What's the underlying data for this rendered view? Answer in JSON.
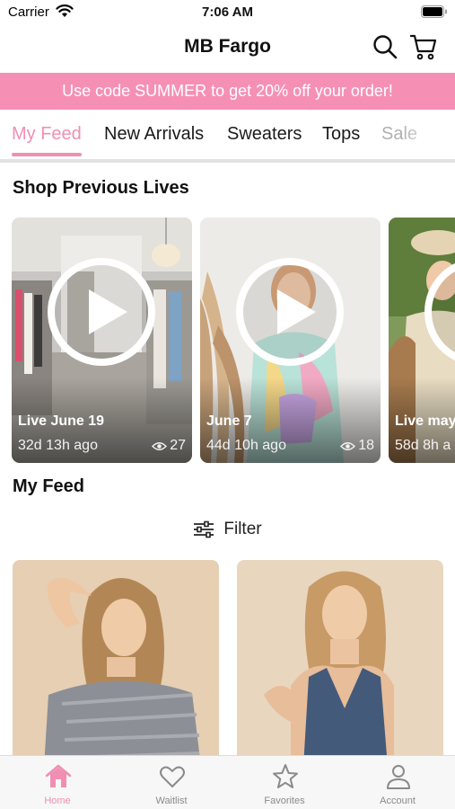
{
  "status_bar": {
    "carrier": "Carrier",
    "time": "7:06 AM"
  },
  "header": {
    "title": "MB Fargo",
    "icons": [
      "search-icon",
      "cart-icon"
    ]
  },
  "promo": {
    "text": "Use code SUMMER to get 20% off your order!",
    "color": "#f590b4"
  },
  "categories": [
    {
      "label": "My Feed",
      "active": true
    },
    {
      "label": "New Arrivals",
      "active": false
    },
    {
      "label": "Sweaters",
      "active": false
    },
    {
      "label": "Tops",
      "active": false
    },
    {
      "label": "Sale",
      "active": false
    }
  ],
  "lives": {
    "title": "Shop Previous Lives",
    "items": [
      {
        "title": "Live June 19",
        "ago": "32d 13h ago",
        "views": "27"
      },
      {
        "title": "June 7",
        "ago": "44d 10h ago",
        "views": "18"
      },
      {
        "title": "Live may",
        "ago": "58d 8h a",
        "views": ""
      }
    ]
  },
  "feed": {
    "title": "My Feed",
    "filter_label": "Filter"
  },
  "tab_bar": [
    {
      "label": "Home",
      "icon": "home-icon",
      "active": true
    },
    {
      "label": "Waitlist",
      "icon": "heart-icon",
      "active": false
    },
    {
      "label": "Favorites",
      "icon": "star-icon",
      "active": false
    },
    {
      "label": "Account",
      "icon": "person-icon",
      "active": false
    }
  ],
  "colors": {
    "accent_pink": "#f08fb2",
    "banner_pink": "#f590b4",
    "text": "#111111",
    "muted": "#8a8a8a"
  }
}
